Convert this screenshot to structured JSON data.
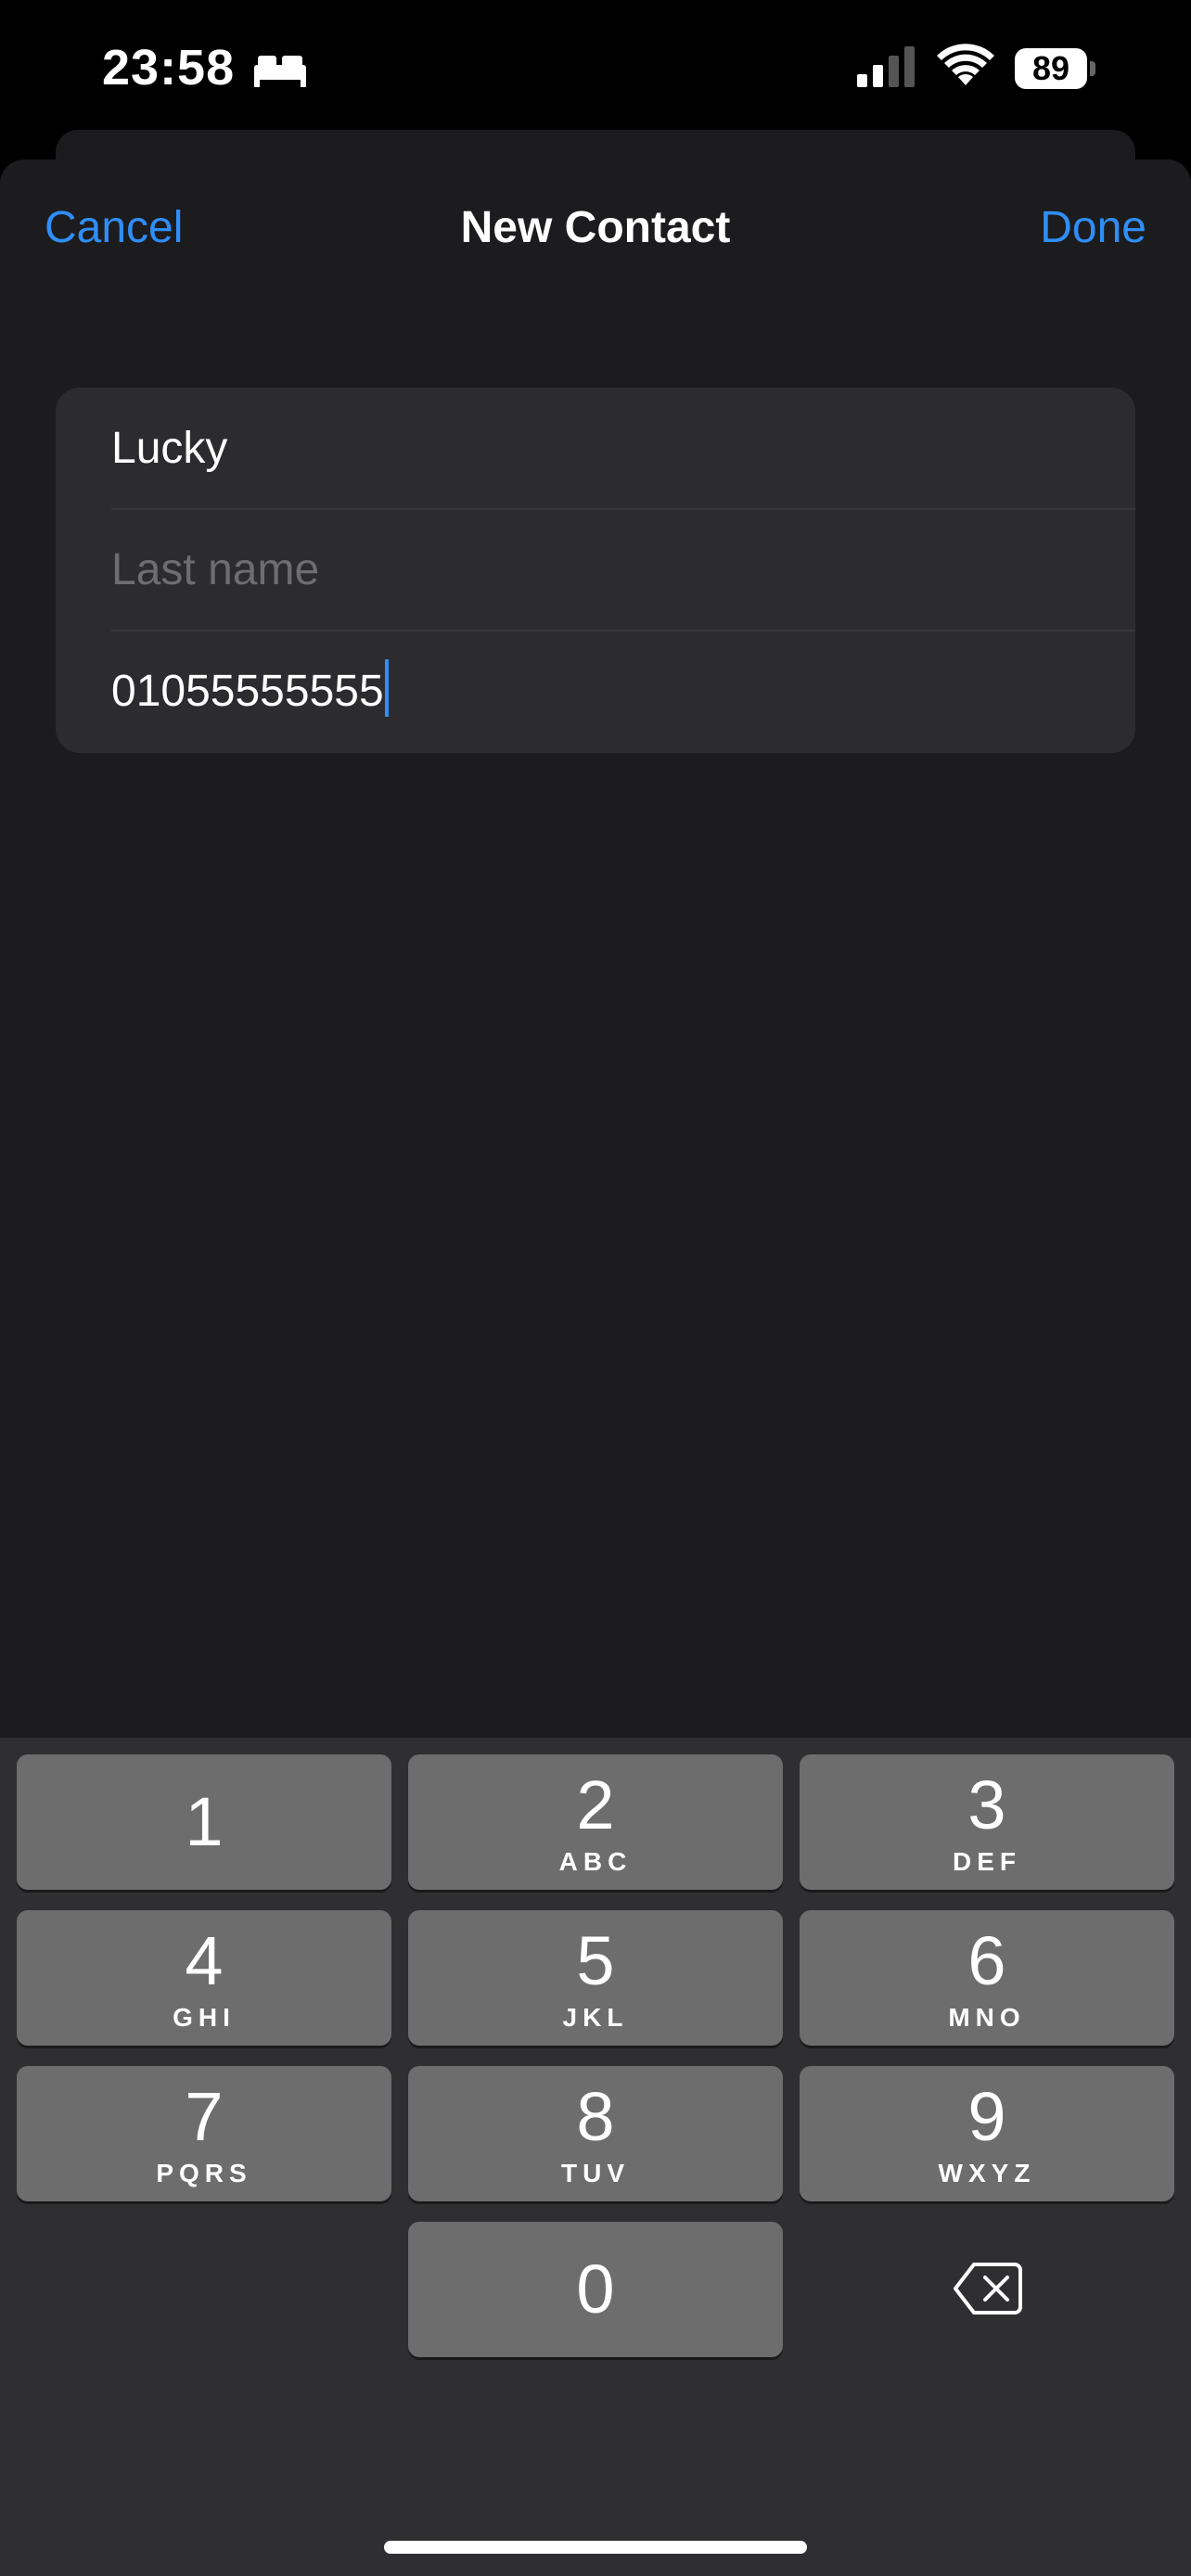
{
  "status_bar": {
    "time": "23:58",
    "battery": "89",
    "icons": [
      "bed-icon",
      "signal-icon",
      "wifi-icon",
      "battery-icon"
    ]
  },
  "nav": {
    "cancel_label": "Cancel",
    "title": "New Contact",
    "done_label": "Done"
  },
  "form": {
    "first_name": "Lucky",
    "last_name_placeholder": "Last name",
    "phone": "01055555555"
  },
  "keypad": {
    "keys": [
      {
        "num": "1",
        "letters": ""
      },
      {
        "num": "2",
        "letters": "ABC"
      },
      {
        "num": "3",
        "letters": "DEF"
      },
      {
        "num": "4",
        "letters": "GHI"
      },
      {
        "num": "5",
        "letters": "JKL"
      },
      {
        "num": "6",
        "letters": "MNO"
      },
      {
        "num": "7",
        "letters": "PQRS"
      },
      {
        "num": "8",
        "letters": "TUV"
      },
      {
        "num": "9",
        "letters": "WXYZ"
      },
      {
        "num": "0",
        "letters": ""
      }
    ]
  },
  "colors": {
    "accent": "#2f8ef7",
    "sheet": "#1c1c1e",
    "card": "#2c2c2e",
    "key": "#6d6d6d",
    "keypad_bg": "#2f2f31"
  }
}
